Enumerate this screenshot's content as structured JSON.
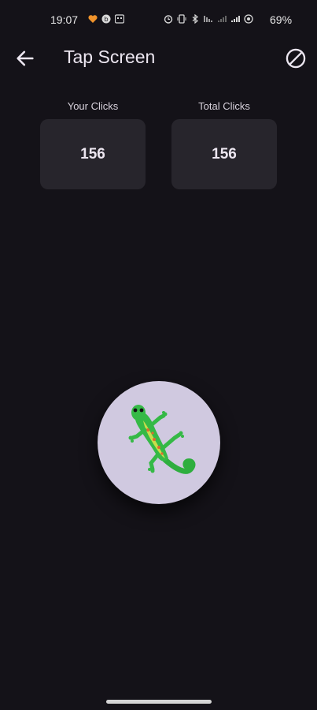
{
  "status_bar": {
    "time": "19:07",
    "battery": "69%",
    "icons": [
      "heart-icon",
      "b-icon",
      "keyboard-icon",
      "alarm-icon",
      "vibrate-icon",
      "bluetooth-icon",
      "volte-icon",
      "signal-icon",
      "signal-icon",
      "target-icon"
    ]
  },
  "app_bar": {
    "title": "Tap Screen",
    "back_icon": "arrow-back-icon",
    "action_icon": "block-icon"
  },
  "stats": {
    "your_clicks_label": "Your Clicks",
    "your_clicks_value": "156",
    "total_clicks_label": "Total Clicks",
    "total_clicks_value": "156"
  },
  "tap_button": {
    "icon": "lizard-icon",
    "background": "#d0c9e0"
  },
  "colors": {
    "background": "#141218",
    "card": "#27252c",
    "text": "#ece6f0"
  }
}
